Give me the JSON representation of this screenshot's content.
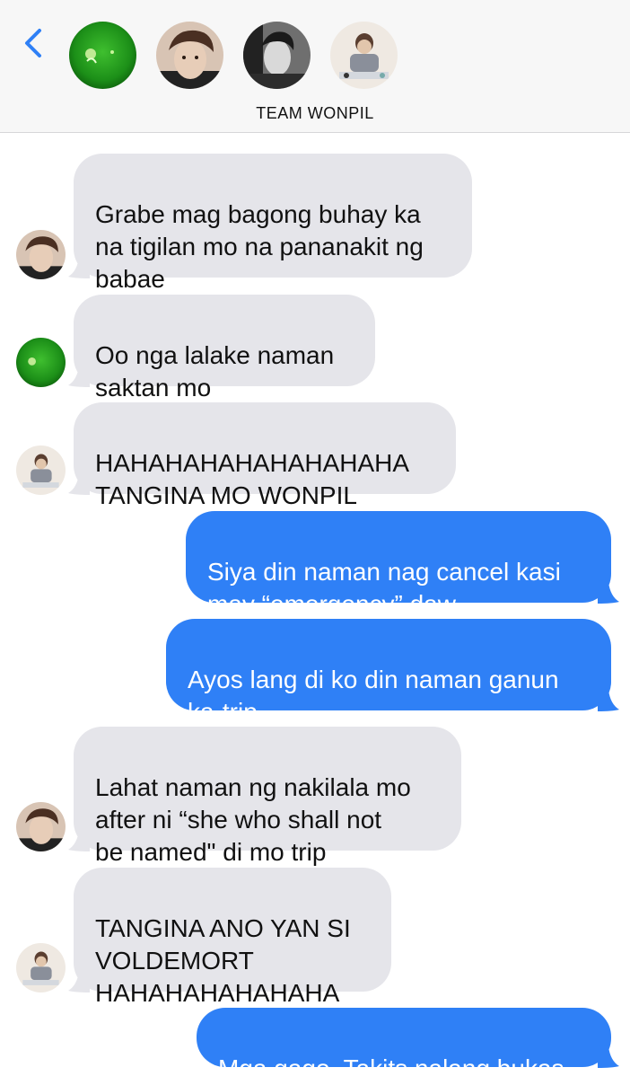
{
  "header": {
    "back_icon": "chevron-left-icon",
    "group_name": "TEAM WONPIL",
    "accent": "#2f80f6"
  },
  "messages": [
    {
      "direction": "incoming",
      "text": "Grabe mag bagong buhay ka\nna tigilan mo na pananakit ng\nbabae"
    },
    {
      "direction": "incoming",
      "text": "Oo nga lalake naman\nsaktan mo"
    },
    {
      "direction": "incoming",
      "text": "HAHAHAHAHAHAHAHAHA\nTANGINA MO WONPIL"
    },
    {
      "direction": "outgoing",
      "text": "Siya din naman nag cancel kasi\nmay “emergency” daw"
    },
    {
      "direction": "outgoing",
      "text": "Ayos lang di ko din naman ganun\nka-trip"
    },
    {
      "direction": "incoming",
      "text": "Lahat naman ng nakilala mo\nafter  ni “she who shall not\nbe named\" di mo trip"
    },
    {
      "direction": "incoming",
      "text": "TANGINA ANO YAN SI\nVOLDEMORT\nHAHAHAHAHAHAHA"
    },
    {
      "direction": "outgoing",
      "text": "Mga gago. Takits nalang bukas"
    }
  ],
  "colors": {
    "incoming_bubble": "#e5e5ea",
    "outgoing_bubble": "#2f80f6",
    "header_bg": "#f7f7f7"
  }
}
